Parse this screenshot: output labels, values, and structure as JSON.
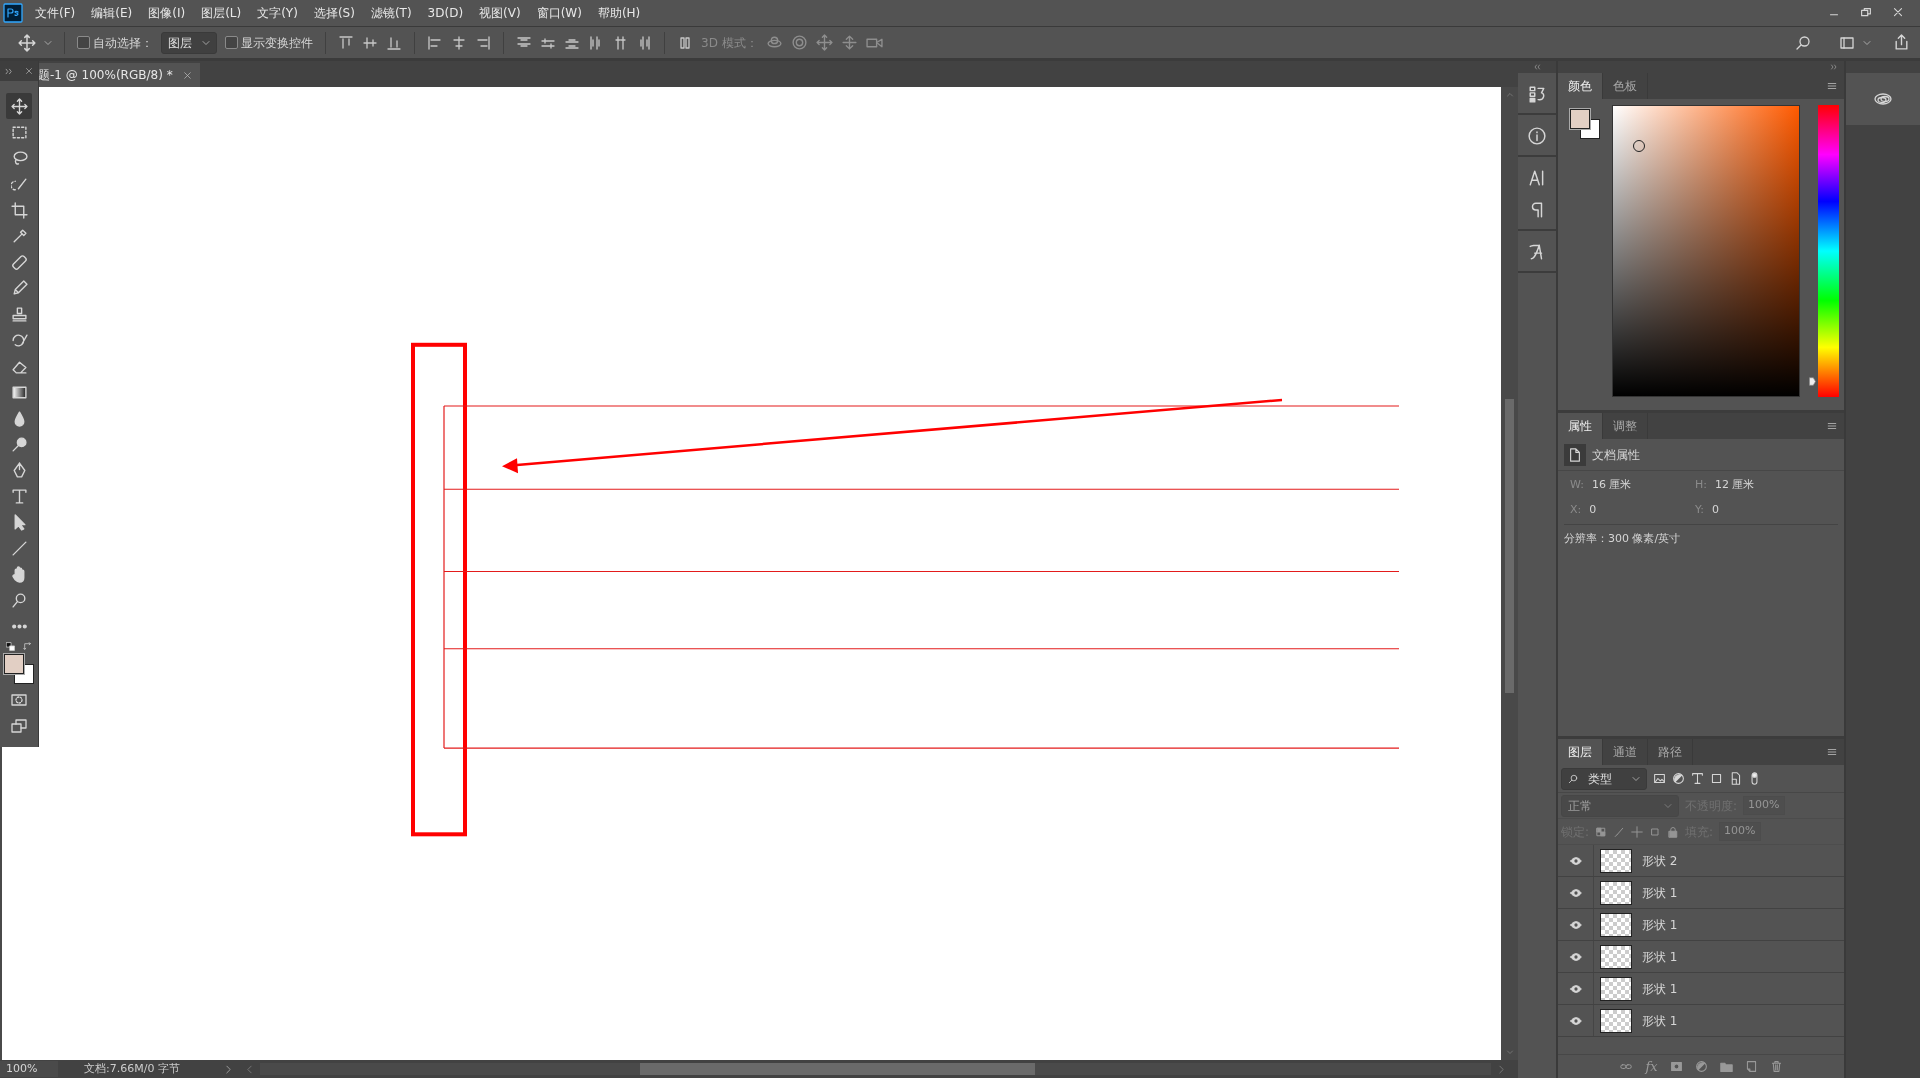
{
  "menu": [
    {
      "label": "文件(F)"
    },
    {
      "label": "编辑(E)"
    },
    {
      "label": "图像(I)"
    },
    {
      "label": "图层(L)"
    },
    {
      "label": "文字(Y)"
    },
    {
      "label": "选择(S)"
    },
    {
      "label": "滤镜(T)"
    },
    {
      "label": "3D(D)"
    },
    {
      "label": "视图(V)"
    },
    {
      "label": "窗口(W)"
    },
    {
      "label": "帮助(H)"
    }
  ],
  "options_bar": {
    "auto_select": {
      "label": "自动选择：",
      "checked": false
    },
    "target": "图层",
    "show_transform": {
      "label": "显示变换控件",
      "checked": false
    },
    "mode_3d_label": "3D 模式："
  },
  "document_tab": {
    "title": "题-1 @ 100%(RGB/8) *"
  },
  "color_panel": {
    "tabs": [
      {
        "label": "颜色",
        "selected": true
      },
      {
        "label": "色板",
        "selected": false
      }
    ],
    "hue": {
      "level": 0.05
    }
  },
  "properties_panel": {
    "tabs": [
      {
        "label": "属性",
        "selected": true
      },
      {
        "label": "调整",
        "selected": false
      }
    ],
    "section": "文档属性",
    "fields": [
      {
        "label": "W:",
        "value": "16 厘米"
      },
      {
        "label": "H:",
        "value": "12 厘米"
      },
      {
        "label": "X:",
        "value": "0"
      },
      {
        "label": "Y:",
        "value": "0"
      }
    ],
    "resolution": "分辨率：300 像素/英寸"
  },
  "layers_panel": {
    "tabs": [
      {
        "label": "图层",
        "selected": true
      },
      {
        "label": "通道",
        "selected": false
      },
      {
        "label": "路径",
        "selected": false
      }
    ],
    "filter": "类型",
    "blend_mode": "正常",
    "opacity_label": "不透明度:",
    "opacity": "100%",
    "lock_label": "锁定:",
    "fill_label": "填充:",
    "fill": "100%",
    "controls_disabled": true,
    "layers": [
      {
        "name": "形状 2",
        "visible": true
      },
      {
        "name": "形状 1",
        "visible": true
      },
      {
        "name": "形状 1",
        "visible": true
      },
      {
        "name": "形状 1",
        "visible": true
      },
      {
        "name": "形状 1",
        "visible": true
      },
      {
        "name": "形状 1",
        "visible": true
      }
    ],
    "fx_label": "fx"
  },
  "status_bar": {
    "zoom": "100%",
    "doc_info": "文档:7.66M/0 字节"
  }
}
